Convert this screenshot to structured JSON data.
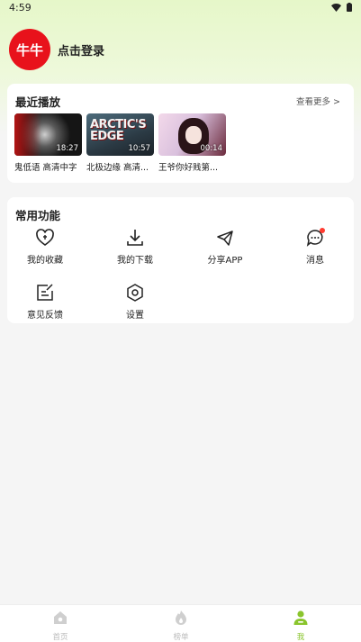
{
  "status_bar": {
    "time": "4:59",
    "icons": [
      "wifi-icon",
      "battery-icon"
    ]
  },
  "profile": {
    "avatar_text": "牛牛",
    "login_label": "点击登录"
  },
  "recent": {
    "title": "最近播放",
    "more_label": "查看更多 >",
    "items": [
      {
        "caption": "鬼低语 高清中字",
        "duration": "18:27"
      },
      {
        "caption": "北极边缘 高清...",
        "duration": "10:57",
        "poster_text": "ARCTIC'S EDGE"
      },
      {
        "caption": "王爷你好贱第...",
        "duration": "00:14"
      }
    ]
  },
  "features": {
    "title": "常用功能",
    "items": [
      {
        "label": "我的收藏",
        "icon": "heart-icon"
      },
      {
        "label": "我的下载",
        "icon": "download-icon"
      },
      {
        "label": "分享APP",
        "icon": "share-icon"
      },
      {
        "label": "消息",
        "icon": "message-icon"
      },
      {
        "label": "意见反馈",
        "icon": "feedback-icon"
      },
      {
        "label": "设置",
        "icon": "settings-icon"
      }
    ]
  },
  "bottom_nav": {
    "items": [
      {
        "label": "首页",
        "icon": "home-icon",
        "active": false
      },
      {
        "label": "榜单",
        "icon": "fire-icon",
        "active": false
      },
      {
        "label": "我",
        "icon": "user-icon",
        "active": true
      }
    ]
  },
  "colors": {
    "accent": "#8ac52d",
    "avatar_bg": "#e8121b",
    "badge": "#ff3b30"
  }
}
